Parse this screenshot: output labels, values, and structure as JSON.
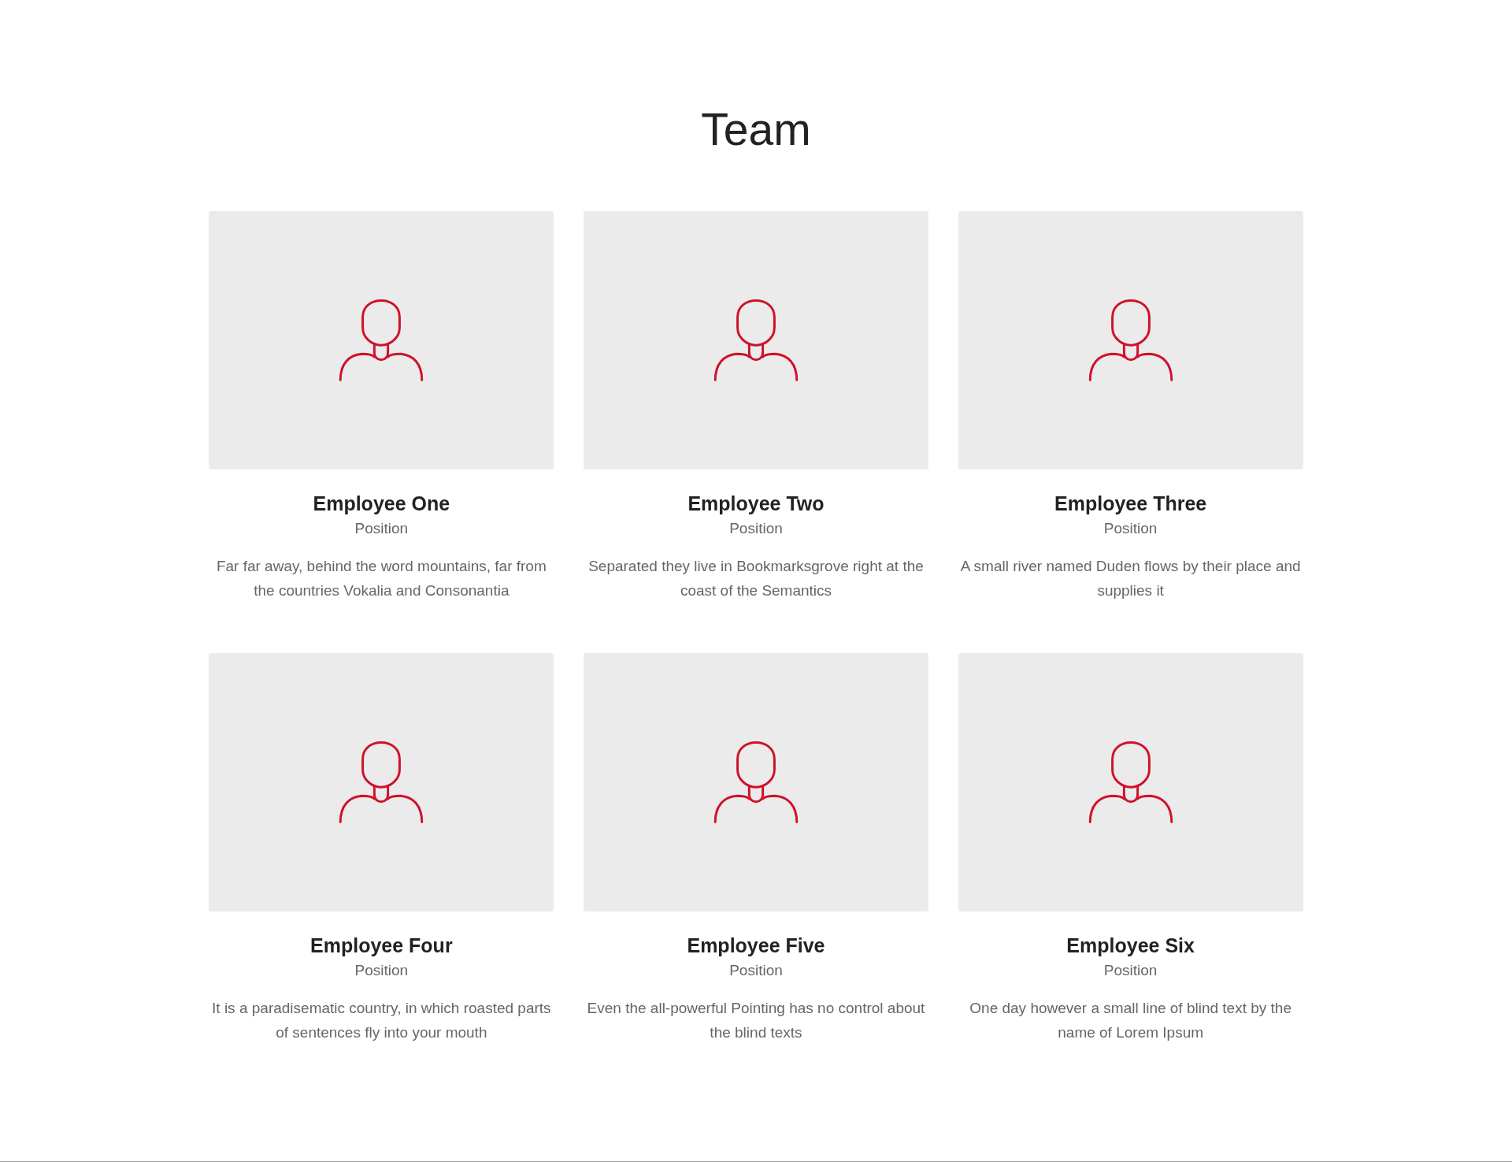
{
  "title": "Team",
  "members": [
    {
      "name": "Employee One",
      "position": "Position",
      "bio": "Far far away, behind the word mountains, far from the countries Vokalia and Consonantia"
    },
    {
      "name": "Employee Two",
      "position": "Position",
      "bio": "Separated they live in Bookmarksgrove right at the coast of the Semantics"
    },
    {
      "name": "Employee Three",
      "position": "Position",
      "bio": "A small river named Duden flows by their place and supplies it"
    },
    {
      "name": "Employee Four",
      "position": "Position",
      "bio": "It is a paradisematic country, in which roasted parts of sentences fly into your mouth"
    },
    {
      "name": "Employee Five",
      "position": "Position",
      "bio": "Even the all-powerful Pointing has no control about the blind texts"
    },
    {
      "name": "Employee Six",
      "position": "Position",
      "bio": "One day however a small line of blind text by the name of Lorem Ipsum"
    }
  ]
}
